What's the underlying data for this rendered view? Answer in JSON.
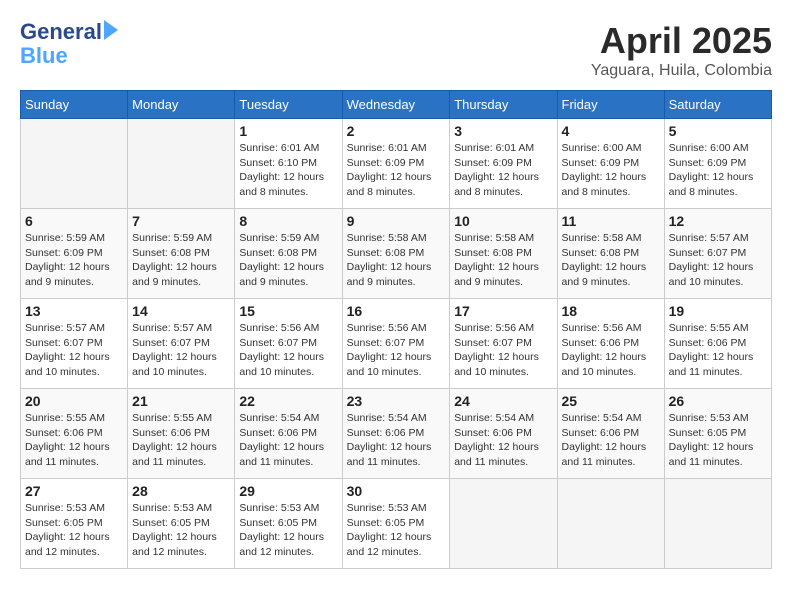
{
  "header": {
    "logo_line1": "General",
    "logo_line2": "Blue",
    "month_title": "April 2025",
    "location": "Yaguara, Huila, Colombia"
  },
  "weekdays": [
    "Sunday",
    "Monday",
    "Tuesday",
    "Wednesday",
    "Thursday",
    "Friday",
    "Saturday"
  ],
  "weeks": [
    [
      {
        "day": "",
        "info": ""
      },
      {
        "day": "",
        "info": ""
      },
      {
        "day": "1",
        "info": "Sunrise: 6:01 AM\nSunset: 6:10 PM\nDaylight: 12 hours\nand 8 minutes."
      },
      {
        "day": "2",
        "info": "Sunrise: 6:01 AM\nSunset: 6:09 PM\nDaylight: 12 hours\nand 8 minutes."
      },
      {
        "day": "3",
        "info": "Sunrise: 6:01 AM\nSunset: 6:09 PM\nDaylight: 12 hours\nand 8 minutes."
      },
      {
        "day": "4",
        "info": "Sunrise: 6:00 AM\nSunset: 6:09 PM\nDaylight: 12 hours\nand 8 minutes."
      },
      {
        "day": "5",
        "info": "Sunrise: 6:00 AM\nSunset: 6:09 PM\nDaylight: 12 hours\nand 8 minutes."
      }
    ],
    [
      {
        "day": "6",
        "info": "Sunrise: 5:59 AM\nSunset: 6:09 PM\nDaylight: 12 hours\nand 9 minutes."
      },
      {
        "day": "7",
        "info": "Sunrise: 5:59 AM\nSunset: 6:08 PM\nDaylight: 12 hours\nand 9 minutes."
      },
      {
        "day": "8",
        "info": "Sunrise: 5:59 AM\nSunset: 6:08 PM\nDaylight: 12 hours\nand 9 minutes."
      },
      {
        "day": "9",
        "info": "Sunrise: 5:58 AM\nSunset: 6:08 PM\nDaylight: 12 hours\nand 9 minutes."
      },
      {
        "day": "10",
        "info": "Sunrise: 5:58 AM\nSunset: 6:08 PM\nDaylight: 12 hours\nand 9 minutes."
      },
      {
        "day": "11",
        "info": "Sunrise: 5:58 AM\nSunset: 6:08 PM\nDaylight: 12 hours\nand 9 minutes."
      },
      {
        "day": "12",
        "info": "Sunrise: 5:57 AM\nSunset: 6:07 PM\nDaylight: 12 hours\nand 10 minutes."
      }
    ],
    [
      {
        "day": "13",
        "info": "Sunrise: 5:57 AM\nSunset: 6:07 PM\nDaylight: 12 hours\nand 10 minutes."
      },
      {
        "day": "14",
        "info": "Sunrise: 5:57 AM\nSunset: 6:07 PM\nDaylight: 12 hours\nand 10 minutes."
      },
      {
        "day": "15",
        "info": "Sunrise: 5:56 AM\nSunset: 6:07 PM\nDaylight: 12 hours\nand 10 minutes."
      },
      {
        "day": "16",
        "info": "Sunrise: 5:56 AM\nSunset: 6:07 PM\nDaylight: 12 hours\nand 10 minutes."
      },
      {
        "day": "17",
        "info": "Sunrise: 5:56 AM\nSunset: 6:07 PM\nDaylight: 12 hours\nand 10 minutes."
      },
      {
        "day": "18",
        "info": "Sunrise: 5:56 AM\nSunset: 6:06 PM\nDaylight: 12 hours\nand 10 minutes."
      },
      {
        "day": "19",
        "info": "Sunrise: 5:55 AM\nSunset: 6:06 PM\nDaylight: 12 hours\nand 11 minutes."
      }
    ],
    [
      {
        "day": "20",
        "info": "Sunrise: 5:55 AM\nSunset: 6:06 PM\nDaylight: 12 hours\nand 11 minutes."
      },
      {
        "day": "21",
        "info": "Sunrise: 5:55 AM\nSunset: 6:06 PM\nDaylight: 12 hours\nand 11 minutes."
      },
      {
        "day": "22",
        "info": "Sunrise: 5:54 AM\nSunset: 6:06 PM\nDaylight: 12 hours\nand 11 minutes."
      },
      {
        "day": "23",
        "info": "Sunrise: 5:54 AM\nSunset: 6:06 PM\nDaylight: 12 hours\nand 11 minutes."
      },
      {
        "day": "24",
        "info": "Sunrise: 5:54 AM\nSunset: 6:06 PM\nDaylight: 12 hours\nand 11 minutes."
      },
      {
        "day": "25",
        "info": "Sunrise: 5:54 AM\nSunset: 6:06 PM\nDaylight: 12 hours\nand 11 minutes."
      },
      {
        "day": "26",
        "info": "Sunrise: 5:53 AM\nSunset: 6:05 PM\nDaylight: 12 hours\nand 11 minutes."
      }
    ],
    [
      {
        "day": "27",
        "info": "Sunrise: 5:53 AM\nSunset: 6:05 PM\nDaylight: 12 hours\nand 12 minutes."
      },
      {
        "day": "28",
        "info": "Sunrise: 5:53 AM\nSunset: 6:05 PM\nDaylight: 12 hours\nand 12 minutes."
      },
      {
        "day": "29",
        "info": "Sunrise: 5:53 AM\nSunset: 6:05 PM\nDaylight: 12 hours\nand 12 minutes."
      },
      {
        "day": "30",
        "info": "Sunrise: 5:53 AM\nSunset: 6:05 PM\nDaylight: 12 hours\nand 12 minutes."
      },
      {
        "day": "",
        "info": ""
      },
      {
        "day": "",
        "info": ""
      },
      {
        "day": "",
        "info": ""
      }
    ]
  ]
}
